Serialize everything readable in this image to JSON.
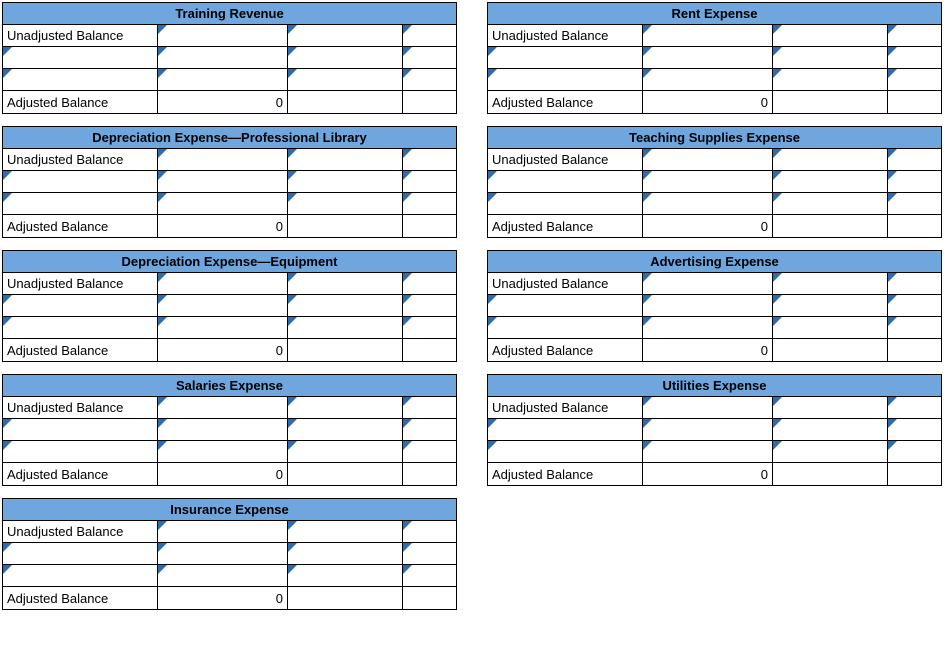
{
  "labels": {
    "unadjusted": "Unadjusted Balance",
    "adjusted": "Adjusted Balance"
  },
  "zero": "0",
  "left_accounts": [
    {
      "title": "Training Revenue"
    },
    {
      "title": "Depreciation Expense—Professional Library"
    },
    {
      "title": "Depreciation Expense—Equipment"
    },
    {
      "title": "Salaries Expense"
    },
    {
      "title": "Insurance Expense"
    }
  ],
  "right_accounts": [
    {
      "title": "Rent Expense"
    },
    {
      "title": "Teaching Supplies Expense"
    },
    {
      "title": "Advertising Expense"
    },
    {
      "title": "Utilities Expense"
    }
  ]
}
